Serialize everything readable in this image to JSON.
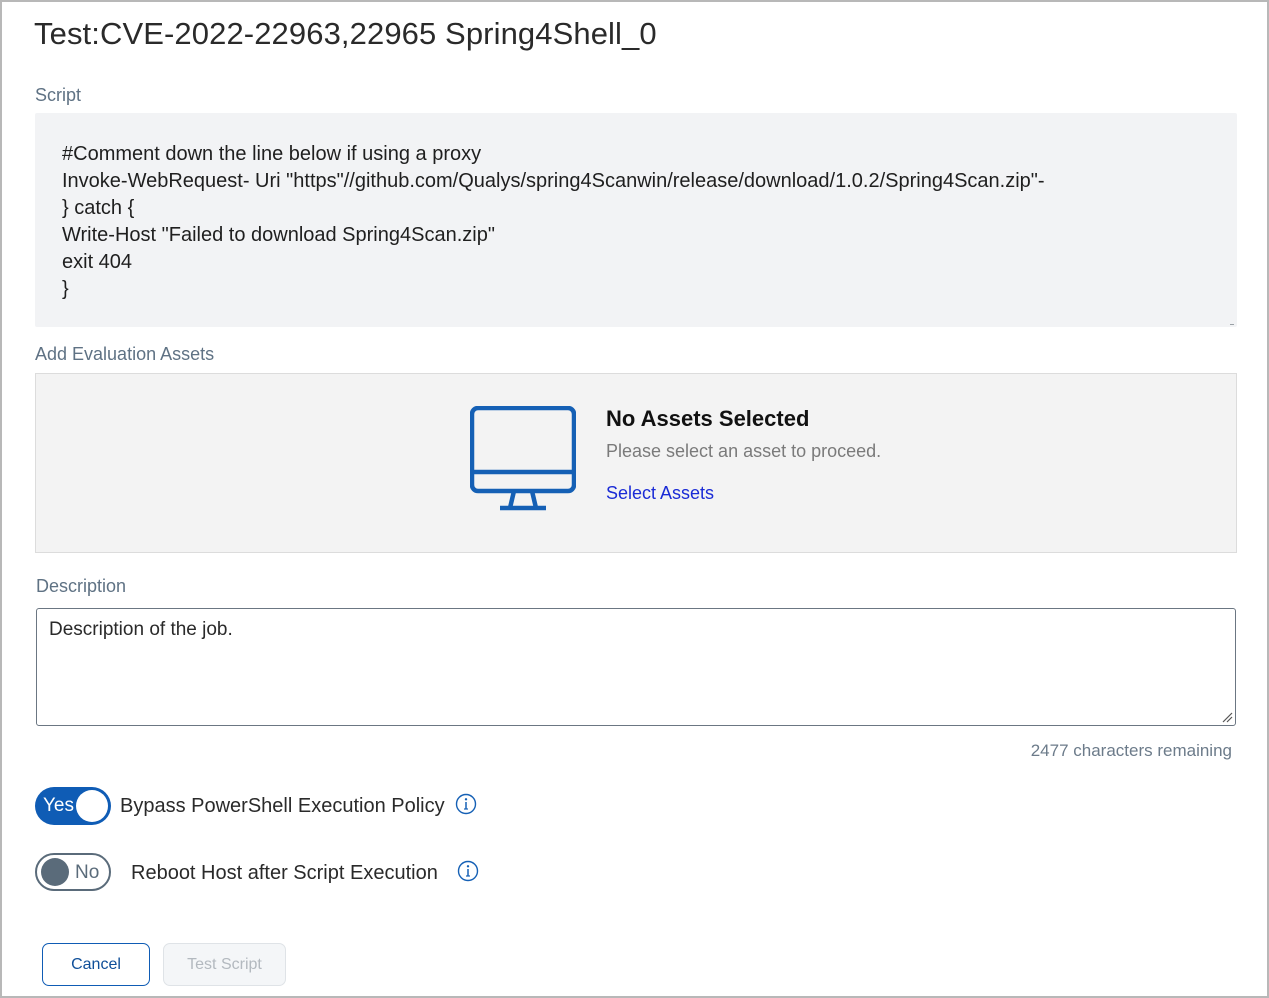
{
  "page": {
    "title": "Test:CVE-2022-22963,22965 Spring4Shell_0"
  },
  "script": {
    "label": "Script",
    "lines": [
      "#Comment down the line below if using a proxy",
      "Invoke-WebRequest- Uri \"https\"//github.com/Qualys/spring4Scanwin/release/download/1.0.2/Spring4Scan.zip\"-",
      "} catch {",
      "Write-Host \"Failed to download Spring4Scan.zip\"",
      "exit 404",
      "}"
    ]
  },
  "assets": {
    "label": "Add Evaluation Assets",
    "empty_title": "No Assets Selected",
    "empty_message": "Please select an asset to proceed.",
    "select_link": "Select Assets",
    "icon": "monitor-icon",
    "icon_color": "#1560b5"
  },
  "description": {
    "label": "Description",
    "value": "Description of the job.",
    "chars_remaining": "2477 characters remaining"
  },
  "options": {
    "bypass": {
      "state_label": "Yes",
      "enabled": true,
      "label": "Bypass PowerShell Execution Policy"
    },
    "reboot": {
      "state_label": "No",
      "enabled": false,
      "label": "Reboot Host after Script Execution"
    },
    "info_icon": "info-icon"
  },
  "footer": {
    "cancel_label": "Cancel",
    "test_label": "Test Script"
  },
  "colors": {
    "primary": "#0f5cb5",
    "link": "#1a2bd6",
    "label": "#5f7284",
    "toggle_off": "#5a6b7a"
  }
}
